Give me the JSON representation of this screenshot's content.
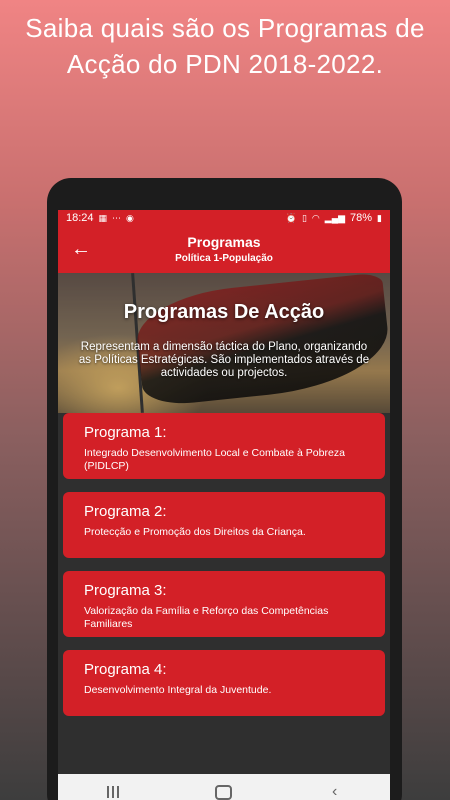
{
  "promo": {
    "title_line1": "Saiba quais são os Programas de",
    "title_line2": "Acção do PDN 2018-2022."
  },
  "statusbar": {
    "time": "18:24",
    "battery": "78%",
    "icons_left": [
      "grid-icon",
      "dots-icon",
      "app-icon"
    ],
    "icons_right": [
      "alarm-icon",
      "vibrate-icon",
      "wifi-icon",
      "signal-icon",
      "battery-icon"
    ]
  },
  "appbar": {
    "title": "Programas",
    "subtitle": "Política 1-População",
    "back_icon": "←"
  },
  "hero": {
    "title": "Programas De Acção",
    "description": "Representam a dimensão táctica do Plano, organizando as Políticas Estratégicas. São implementados através de actividades ou projectos."
  },
  "programs": [
    {
      "title": "Programa 1:",
      "description": "Integrado Desenvolvimento Local e Combate à Pobreza (PIDLCP)"
    },
    {
      "title": "Programa 2:",
      "description": "Protecção e Promoção dos Direitos da Criança."
    },
    {
      "title": "Programa 3:",
      "description": "Valorização da Família e Reforço das Competências Familiares"
    },
    {
      "title": "Programa 4:",
      "description": "Desenvolvimento Integral da Juventude."
    }
  ],
  "navbar": {
    "back_glyph": "‹"
  },
  "colors": {
    "accent": "#d32027",
    "navbar": "#f2f2f2"
  }
}
